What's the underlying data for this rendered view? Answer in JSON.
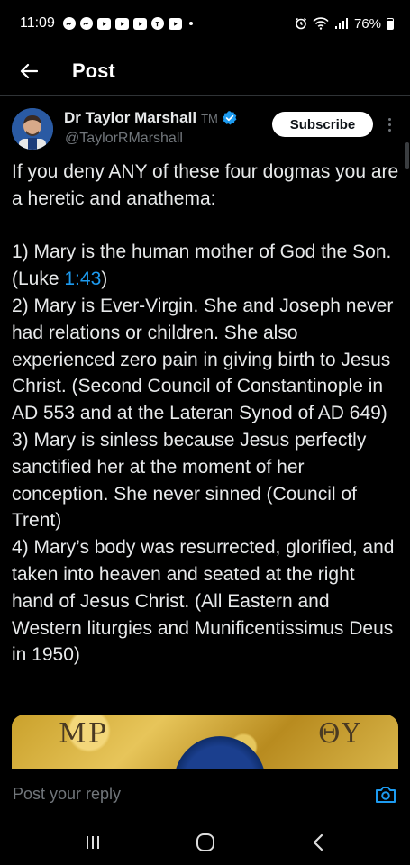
{
  "status_bar": {
    "time": "11:09",
    "battery": "76%"
  },
  "header": {
    "title": "Post"
  },
  "post": {
    "author_name": "Dr Taylor Marshall",
    "author_badge": "TM",
    "handle": "@TaylorRMarshall",
    "subscribe_label": "Subscribe",
    "text_intro": "If you deny ANY of these four dogmas you are a heretic and anathema:",
    "point1_a": "1) Mary is the human mother of God the Son. (Luke ",
    "point1_ref": "1:43",
    "point1_b": ")",
    "point2": "2) Mary is Ever-Virgin. She and Joseph never had relations or children. She also experienced zero pain in giving birth to Jesus Christ. (Second Council of Constantinople in AD 553 and at the Lateran Synod of AD 649)",
    "point3": "3) Mary is sinless because Jesus perfectly sanctified her at the moment of her conception. She never sinned (Council of Trent)",
    "point4": "4) Mary’s body was resurrected, glorified, and taken into heaven and seated at the right hand of Jesus Christ. (All Eastern and Western liturgies and Munificentissimus Deus in 1950)",
    "media_text_left": "MP",
    "media_text_right": "ΘY"
  },
  "reply": {
    "placeholder": "Post your reply"
  },
  "colors": {
    "background": "#000000",
    "text": "#e7e9ea",
    "secondary": "#71767b",
    "link": "#1d9bf0",
    "verified": "#1d9bf0"
  }
}
